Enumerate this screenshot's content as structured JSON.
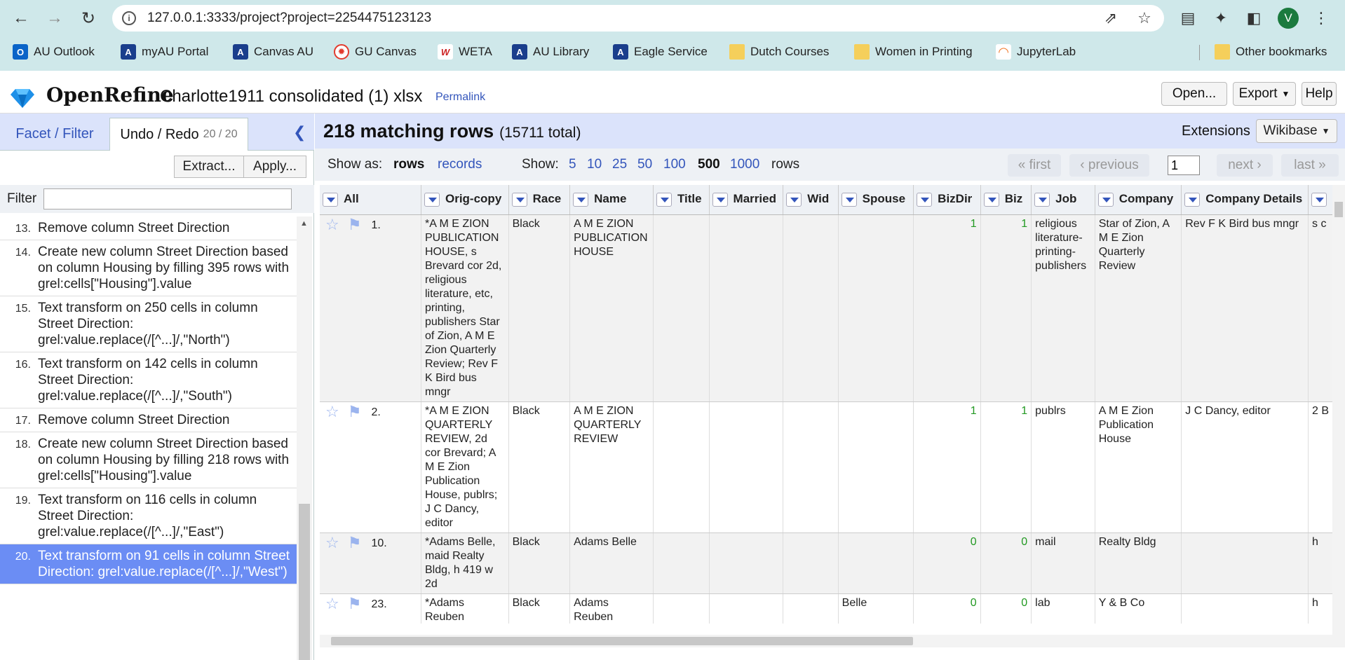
{
  "browser": {
    "url": "127.0.0.1:3333/project?project=2254475123123",
    "avatar_letter": "V",
    "bookmarks": [
      {
        "label": "AU Outlook",
        "icon": "outlook-icon",
        "color": "#0a64c8"
      },
      {
        "label": "myAU Portal",
        "icon": "au-icon",
        "color": "#c8102e"
      },
      {
        "label": "Canvas AU",
        "icon": "au-icon",
        "color": "#c8102e"
      },
      {
        "label": "GU Canvas",
        "icon": "canvas-icon",
        "color": "#e23b2e"
      },
      {
        "label": "WETA",
        "icon": "weta-icon",
        "color": "#cc2222"
      },
      {
        "label": "AU Library",
        "icon": "au-icon",
        "color": "#1a3e8c"
      },
      {
        "label": "Eagle Service",
        "icon": "au-icon",
        "color": "#c8102e"
      },
      {
        "label": "Dutch Courses",
        "icon": "folder-icon",
        "color": "#f5cf5b"
      },
      {
        "label": "Women in Printing",
        "icon": "folder-icon",
        "color": "#f5cf5b"
      },
      {
        "label": "JupyterLab",
        "icon": "jupyter-icon",
        "color": "#f37726"
      },
      {
        "label": "Other bookmarks",
        "icon": "folder-icon",
        "color": "#f5cf5b"
      }
    ]
  },
  "app": {
    "brand": "OpenRefine",
    "project_name": "Charlotte1911 consolidated (1) xlsx",
    "permalink": "Permalink",
    "open_label": "Open...",
    "export_label": "Export",
    "help_label": "Help"
  },
  "left": {
    "tab_facet": "Facet / Filter",
    "tab_undo": "Undo / Redo",
    "undo_count": "20 / 20",
    "extract_label": "Extract...",
    "apply_label": "Apply...",
    "filter_label": "Filter",
    "history": [
      {
        "num": "13.",
        "text": "Remove column Street Direction"
      },
      {
        "num": "14.",
        "text": "Create new column Street Direction based on column Housing by filling 395 rows with grel:cells[\"Housing\"].value"
      },
      {
        "num": "15.",
        "text": "Text transform on 250 cells in column Street Direction: grel:value.replace(/[^...]/,\"North\")"
      },
      {
        "num": "16.",
        "text": "Text transform on 142 cells in column Street Direction: grel:value.replace(/[^...]/,\"South\")"
      },
      {
        "num": "17.",
        "text": "Remove column Street Direction"
      },
      {
        "num": "18.",
        "text": "Create new column Street Direction based on column Housing by filling 218 rows with grel:cells[\"Housing\"].value"
      },
      {
        "num": "19.",
        "text": "Text transform on 116 cells in column Street Direction: grel:value.replace(/[^...]/,\"East\")"
      },
      {
        "num": "20.",
        "text": "Text transform on 91 cells in column Street Direction: grel:value.replace(/[^...]/,\"West\")"
      }
    ]
  },
  "right": {
    "matching": "218 matching rows",
    "total": "(15711 total)",
    "extensions_label": "Extensions",
    "wikibase_label": "Wikibase",
    "show_as_label": "Show as:",
    "rows_label": "rows",
    "records_label": "records",
    "show_label": "Show:",
    "page_sizes": [
      "5",
      "10",
      "25",
      "50",
      "100",
      "500",
      "1000"
    ],
    "rows_suffix": "rows",
    "first_label": "« first",
    "previous_label": "‹ previous",
    "page_value": "1",
    "next_label": "next ›",
    "last_label": "last »"
  },
  "grid": {
    "columns": [
      "All",
      "Orig-copy",
      "Race",
      "Name",
      "Title",
      "Married",
      "Wid",
      "Spouse",
      "BizDir",
      "Biz",
      "Job",
      "Company",
      "Company Details",
      ""
    ],
    "rows": [
      {
        "num": "1.",
        "orig": "*A M E ZION PUBLICATION HOUSE, s Brevard cor 2d, religious literature, etc, printing, publishers Star of Zion, A M E Zion Quarterly Review; Rev F K Bird bus mngr",
        "race": "Black",
        "name": "A M E ZION PUBLICATION HOUSE",
        "title": "",
        "married": "",
        "wid": "",
        "spouse": "",
        "bizdir": "1",
        "biz": "1",
        "job": "religious literature-printing-publishers",
        "company": "Star of Zion, A M E Zion Quarterly Review",
        "details": "Rev F K Bird bus mngr",
        "extra": "s c"
      },
      {
        "num": "2.",
        "orig": "*A M E ZION QUARTERLY REVIEW, 2d cor Brevard; A M E Zion Publication House, publrs; J C Dancy, editor",
        "race": "Black",
        "name": "A M E ZION QUARTERLY REVIEW",
        "title": "",
        "married": "",
        "wid": "",
        "spouse": "",
        "bizdir": "1",
        "biz": "1",
        "job": "publrs",
        "company": "A M E Zion Publication House",
        "details": "J C Dancy, editor",
        "extra": "2 B"
      },
      {
        "num": "10.",
        "orig": "*Adams Belle, maid Realty Bldg, h 419 w 2d",
        "race": "Black",
        "name": "Adams Belle",
        "title": "",
        "married": "",
        "wid": "",
        "spouse": "",
        "bizdir": "0",
        "biz": "0",
        "job": "mail",
        "company": "Realty Bldg",
        "details": "",
        "extra": "h"
      },
      {
        "num": "23.",
        "orig": "*Adams Reuben",
        "race": "Black",
        "name": "Adams Reuben",
        "title": "",
        "married": "",
        "wid": "",
        "spouse": "Belle",
        "bizdir": "0",
        "biz": "0",
        "job": "lab",
        "company": "Y & B Co",
        "details": "",
        "extra": "h"
      }
    ]
  }
}
